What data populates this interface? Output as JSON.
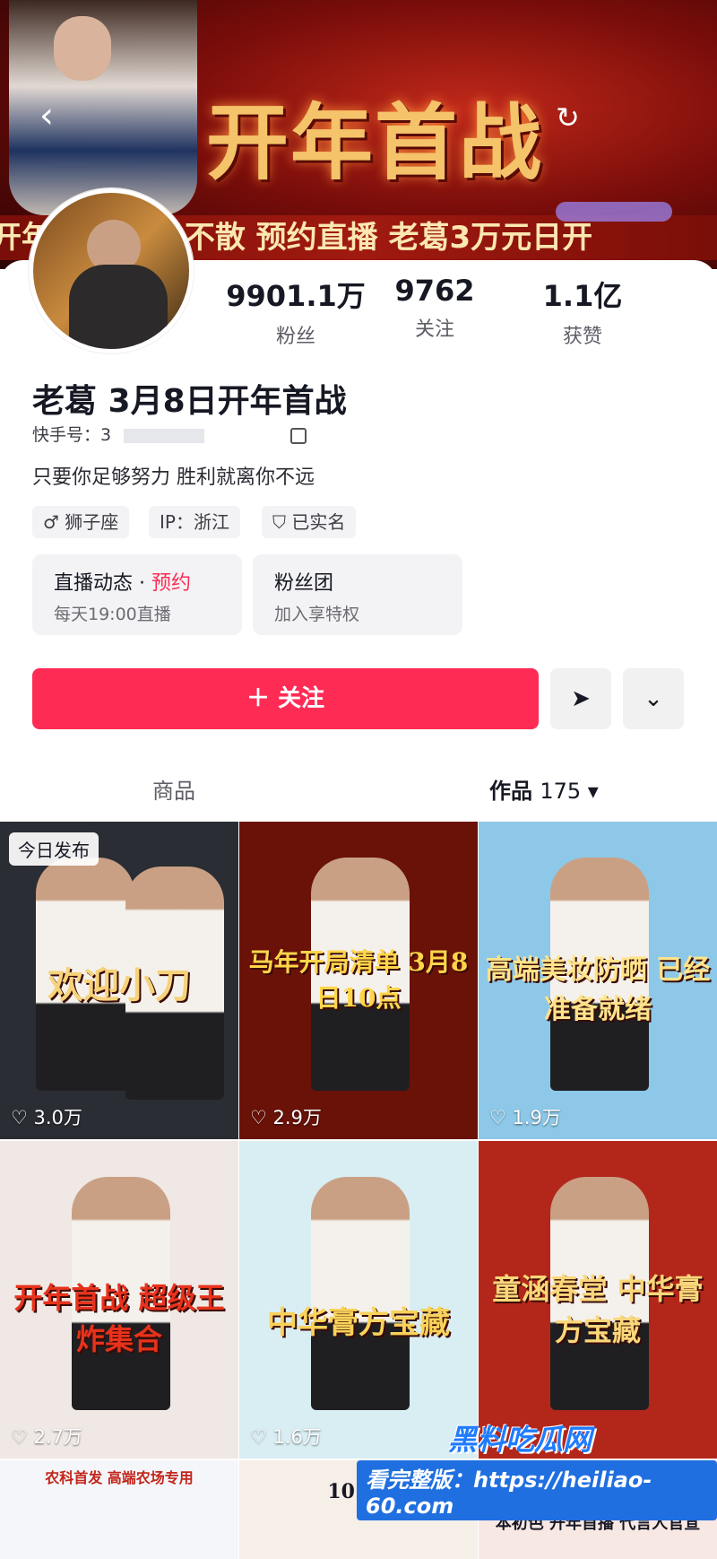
{
  "banner": {
    "title": "开年首战",
    "ticker": "开年首战  不见不散   预约直播   老葛3万元日开",
    "back_icon": "chevron-left-icon",
    "refresh_icon": "refresh-icon"
  },
  "stats": [
    {
      "num": "9901.1万",
      "label": "粉丝"
    },
    {
      "num": "9762",
      "label": "关注"
    },
    {
      "num": "1.1亿",
      "label": "获赞"
    }
  ],
  "profile": {
    "name": "老葛 3月8日开年首战",
    "uid_label": "快手号：3",
    "bio": "只要你足够努力 胜利就离你不远",
    "tags": [
      "♂ 狮子座",
      "IP：浙江",
      "已实名"
    ]
  },
  "tiles": [
    {
      "title": "直播动态 · ",
      "accent": "预约",
      "sub": "每天19:00直播"
    },
    {
      "title": "粉丝团",
      "accent": "",
      "sub": "加入享特权"
    }
  ],
  "actions": {
    "follow_label": "＋ 关注",
    "share_icon": "send-icon",
    "more_icon": "chevron-down-icon"
  },
  "tabs": {
    "products": "商品",
    "works": "作品",
    "works_count": "175 ▾"
  },
  "videos": [
    {
      "caption": "欢迎小刀",
      "likes": "♡ 3.0万",
      "badge": "今日发布",
      "bg": "#2a2d33",
      "cap_color": "#f6d27a"
    },
    {
      "caption": "马年开局清单 3月8日10点",
      "likes": "♡ 2.9万",
      "badge": "",
      "bg": "#6a1208",
      "cap_color": "#ffd54a"
    },
    {
      "caption": "高端美妆防晒 已经准备就绪",
      "likes": "♡ 1.9万",
      "badge": "",
      "bg": "#8dc8e8",
      "cap_color": "#ffe38a"
    },
    {
      "caption": "开年首战 超级王炸集合",
      "likes": "♡ 2.7万",
      "badge": "",
      "bg": "#efe8e4",
      "cap_color": "#e8321c"
    },
    {
      "caption": "中华膏方宝藏",
      "likes": "♡ 1.6万",
      "badge": "",
      "bg": "#d9eef3",
      "cap_color": "#f8d25a"
    },
    {
      "caption": "童涵春堂 中华膏方宝藏",
      "likes": "",
      "badge": "",
      "bg": "#b3261a",
      "cap_color": "#f9d77a"
    }
  ],
  "bottom_row": [
    {
      "caption": "农科首发 高端农场专用",
      "bg": "#f4f6fa"
    },
    {
      "caption": "10:00",
      "bg": "#f6efe8"
    },
    {
      "caption": "本初色 开年首播 代言人官宣",
      "bg": "#f8e8e4"
    }
  ],
  "watermark": {
    "line1": "黑料吃瓜网",
    "line2": "看完整版：https://heiliao-60.com"
  }
}
